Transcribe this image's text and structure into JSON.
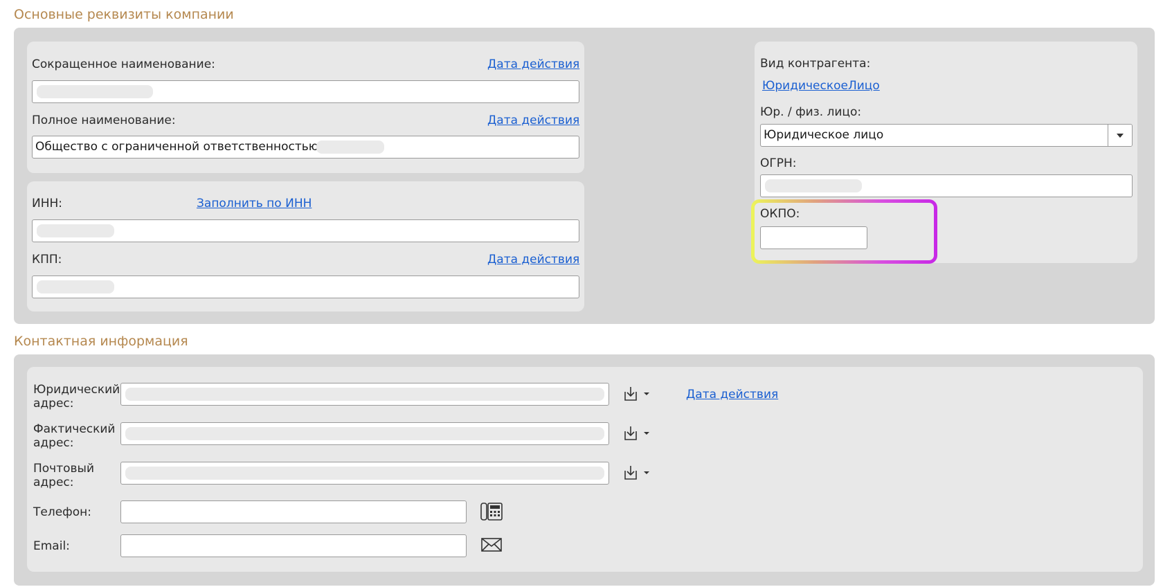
{
  "sections": {
    "main_title": "Основные реквизиты компании",
    "contact_title": "Контактная информация"
  },
  "main": {
    "short_name_label": "Сокращенное наименование:",
    "short_name_link": "Дата действия",
    "full_name_label": "Полное наименование:",
    "full_name_link": "Дата действия",
    "full_name_value": "Общество с ограниченной ответственностью",
    "inn_label": "ИНН:",
    "inn_link": "Заполнить по ИНН",
    "kpp_label": "КПП:",
    "kpp_link": "Дата действия",
    "counterparty_type_label": "Вид контрагента:",
    "counterparty_type_link": "ЮридическоеЛицо",
    "entity_kind_label": "Юр. / физ. лицо:",
    "entity_kind_value": "Юридическое лицо",
    "ogrn_label": "ОГРН:",
    "okpo_label": "ОКПО:"
  },
  "contact": {
    "legal_address_label": "Юридический адрес:",
    "actual_address_label": "Фактический адрес:",
    "postal_address_label": "Почтовый адрес:",
    "phone_label": "Телефон:",
    "email_label": "Email:",
    "address_date_link": "Дата действия"
  },
  "icons": {
    "address_edit": "download-icon",
    "dropdown": "chevron-down-icon",
    "phone": "phone-icon",
    "email": "envelope-icon"
  },
  "colors": {
    "section_title": "#b5884f",
    "link": "#1a5fd1",
    "highlight_start": "#ecf55a",
    "highlight_end": "#c728e6"
  }
}
